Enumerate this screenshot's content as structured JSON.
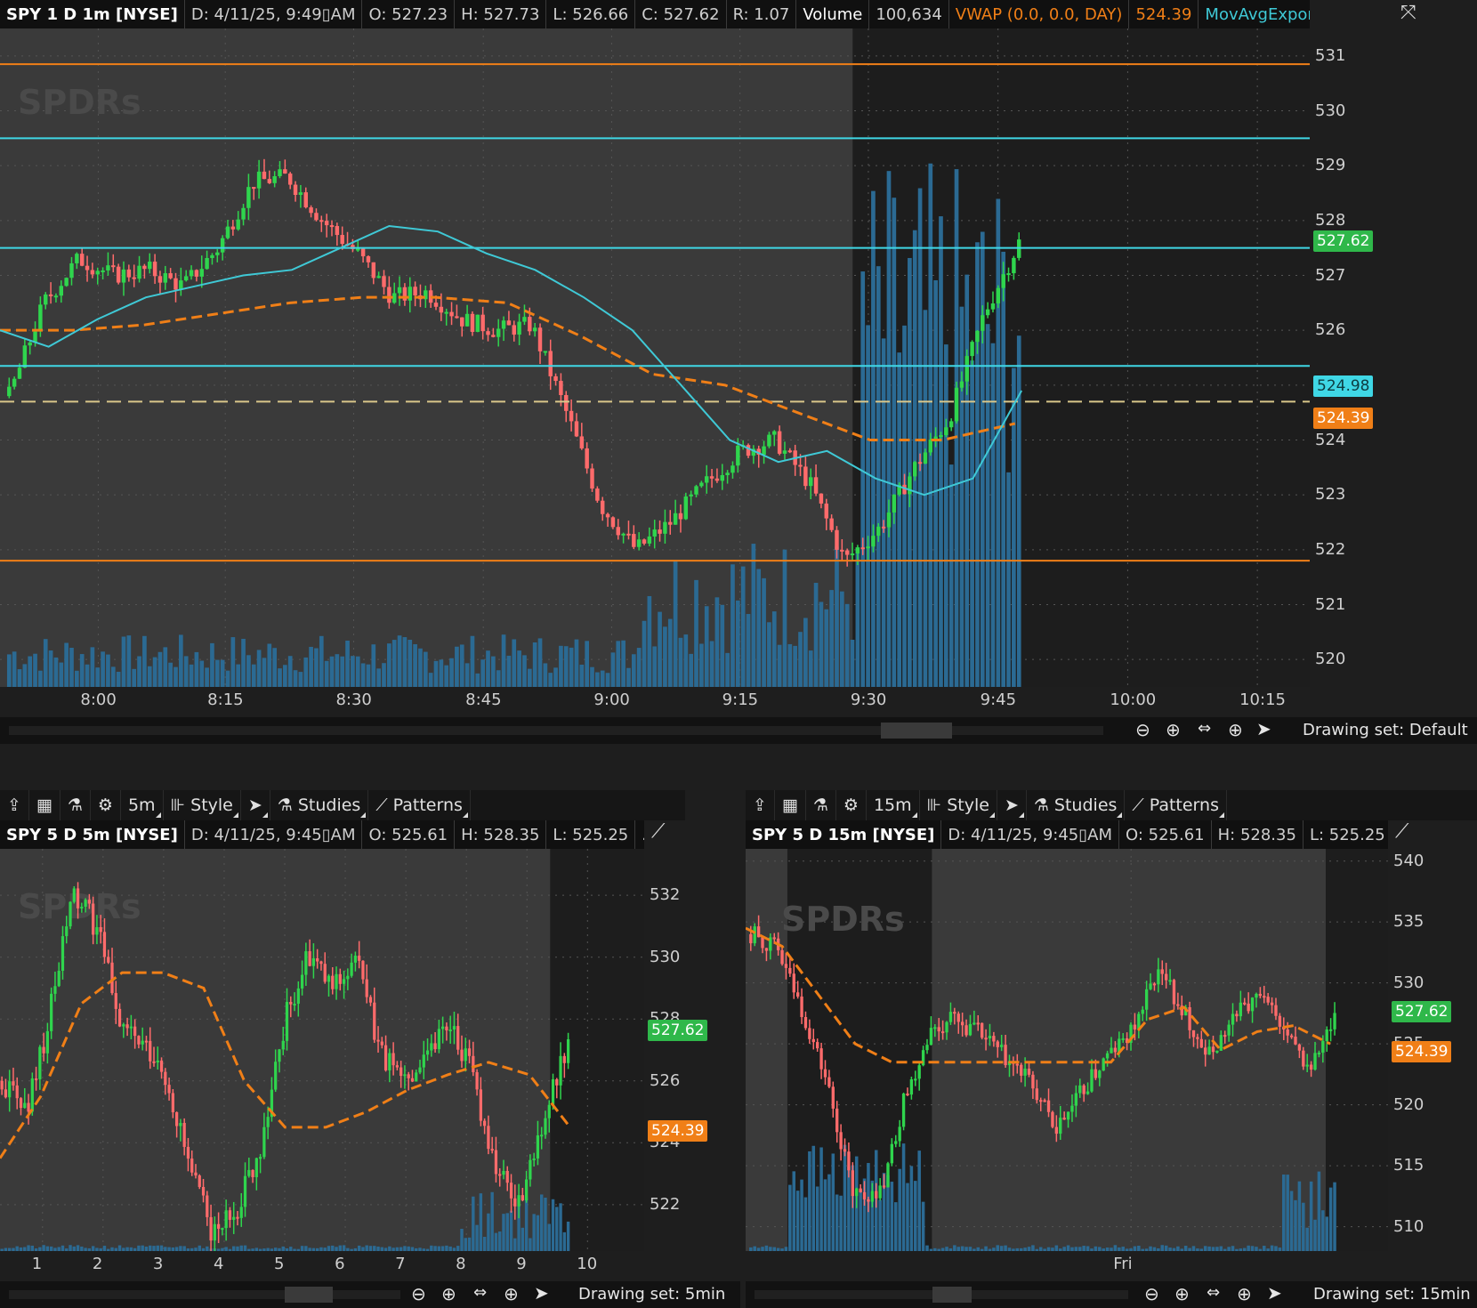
{
  "colors": {
    "up": "#2fd54d",
    "down": "#ff6b6b",
    "vwap": "#f07f17",
    "ema": "#3fc9d6",
    "volume": "#2b6a93",
    "level_orange": "#f07f17",
    "level_cyan": "#3fd7e5",
    "level_yellow": "#d9c78a"
  },
  "main": {
    "header": {
      "symbol": "SPY 1 D 1m [NYSE]",
      "date": "D: 4/11/25, 9:49▯AM",
      "open": "O: 527.23",
      "high": "H: 527.73",
      "low": "L: 526.66",
      "close": "C: 527.62",
      "range": "R: 1.07",
      "volume_label": "Volume",
      "volume_value": "100,634",
      "vwap_label": "VWAP (0.0, 0.0, DAY)",
      "vwap_value": "524.39",
      "ema_label": "MovAvgExponential ..."
    },
    "y_ticks": [
      "531",
      "530",
      "529",
      "528",
      "527",
      "526",
      "525",
      "524",
      "523",
      "522",
      "521",
      "520"
    ],
    "x_ticks": [
      "8:00",
      "8:15",
      "8:30",
      "8:45",
      "9:00",
      "9:15",
      "9:30",
      "9:45",
      "10:00",
      "10:15"
    ],
    "price_tags": {
      "last": "527.62",
      "ema": "524.98",
      "vwap": "524.39"
    },
    "nav": {
      "drawing_set": "Drawing set: Default"
    }
  },
  "left": {
    "toolbar": {
      "interval": "5m",
      "style": "Style",
      "studies": "Studies",
      "patterns": "Patterns"
    },
    "header": {
      "symbol": "SPY 5 D 5m [NYSE]",
      "date": "D: 4/11/25, 9:45▯AM",
      "open": "O: 525.61",
      "high": "H: 528.35",
      "low": "L: 525.25",
      "more": "..."
    },
    "y_ticks": [
      "532",
      "530",
      "528",
      "526",
      "524",
      "522"
    ],
    "x_ticks": [
      "1",
      "2",
      "3",
      "4",
      "5",
      "6",
      "7",
      "8",
      "9",
      "10"
    ],
    "price_tags": {
      "last": "527.62",
      "vwap": "524.39"
    },
    "nav": {
      "drawing_set": "Drawing set: 5min"
    }
  },
  "right": {
    "toolbar": {
      "interval": "15m",
      "style": "Style",
      "studies": "Studies",
      "patterns": "Patterns"
    },
    "header": {
      "symbol": "SPY 5 D 15m [NYSE]",
      "date": "D: 4/11/25, 9:45▯AM",
      "open": "O: 525.61",
      "high": "H: 528.35",
      "low": "L: 525.25",
      "more": "..."
    },
    "y_ticks": [
      "540",
      "535",
      "530",
      "525",
      "520",
      "515",
      "510"
    ],
    "x_ticks": [
      "Fri"
    ],
    "price_tags": {
      "last": "527.62",
      "vwap": "524.39"
    },
    "nav": {
      "drawing_set": "Drawing set: 15min"
    }
  },
  "chart_data": [
    {
      "type": "candlestick",
      "title": "SPY 1 D 1m [NYSE]",
      "ylim": [
        519.5,
        531.5
      ],
      "x_ticks": [
        "8:00",
        "8:15",
        "8:30",
        "8:45",
        "9:00",
        "9:15",
        "9:30",
        "9:45",
        "10:00",
        "10:15"
      ],
      "levels": [
        530.85,
        529.5,
        527.5,
        525.35,
        524.7,
        521.8
      ],
      "vwap_series": [
        526.0,
        526.0,
        526.1,
        526.3,
        526.5,
        526.6,
        526.6,
        526.5,
        525.9,
        525.2,
        525.0,
        524.5,
        524.0,
        524.0,
        524.3
      ]
    },
    {
      "type": "candlestick",
      "title": "SPY 5 D 5m [NYSE]",
      "ylim": [
        520.5,
        533.5
      ],
      "x_ticks": [
        "1",
        "2",
        "3",
        "4",
        "5",
        "6",
        "7",
        "8",
        "9",
        "10"
      ]
    },
    {
      "type": "candlestick",
      "title": "SPY 5 D 15m [NYSE]",
      "ylim": [
        508,
        541
      ],
      "x_ticks": [
        "Fri"
      ]
    }
  ]
}
